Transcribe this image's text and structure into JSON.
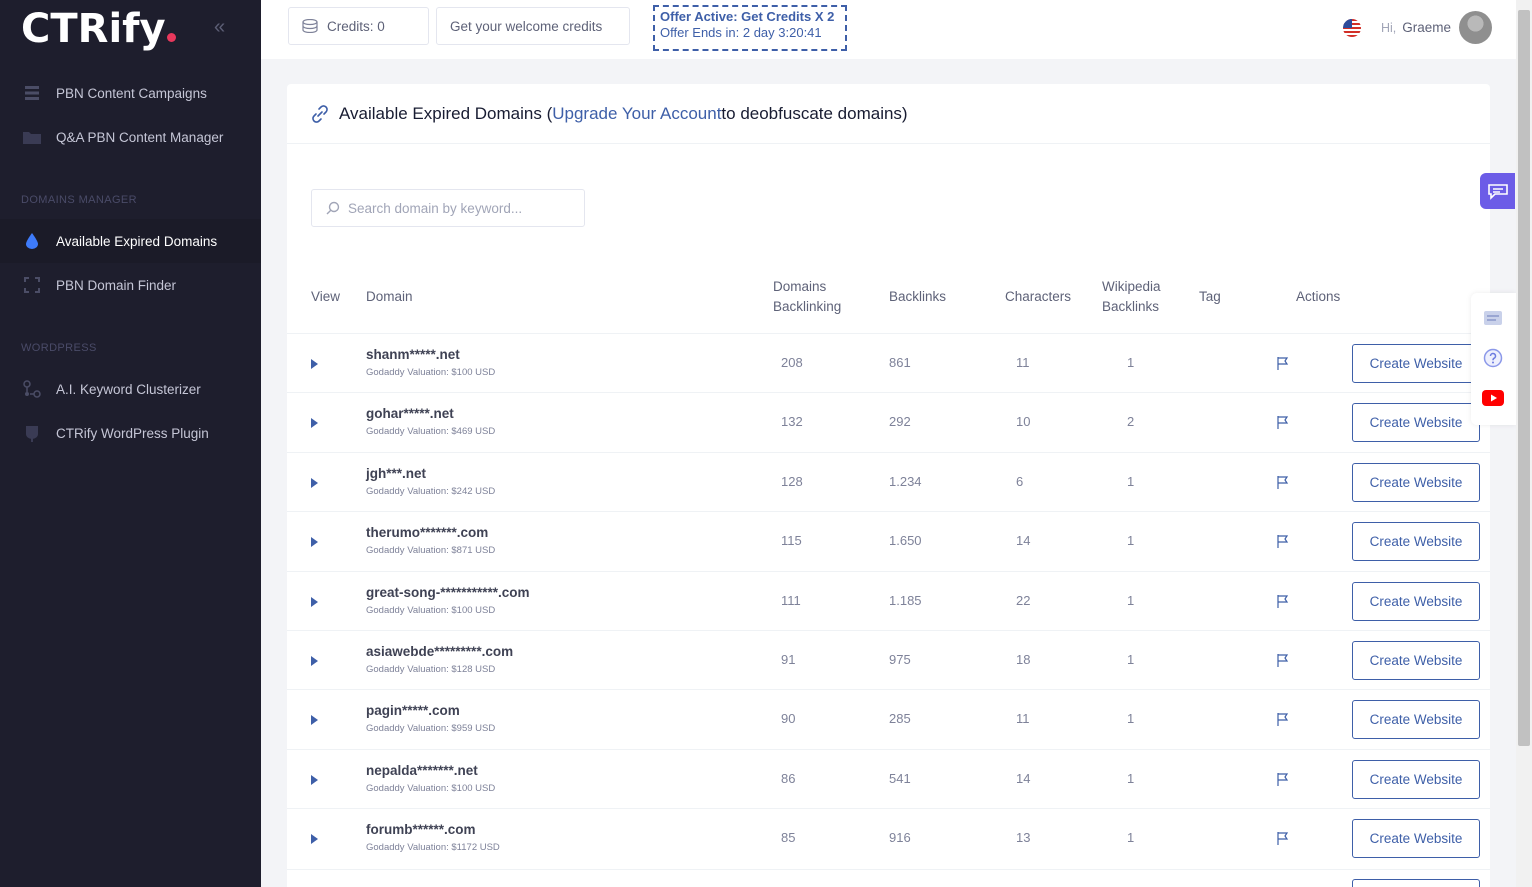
{
  "app": {
    "logo": "CTRify"
  },
  "sidebar": {
    "items": [
      {
        "label": "PBN Content Campaigns",
        "icon": "list-icon"
      },
      {
        "label": "Q&A PBN Content Manager",
        "icon": "folder-icon"
      },
      {
        "label": "Available Expired Domains",
        "icon": "droplet-icon",
        "active": true
      },
      {
        "label": "PBN Domain Finder",
        "icon": "expand-icon"
      },
      {
        "label": "A.I. Keyword Clusterizer",
        "icon": "cluster-icon"
      },
      {
        "label": "CTRify WordPress Plugin",
        "icon": "plugin-icon"
      }
    ],
    "sections": {
      "domains": "DOMAINS MANAGER",
      "wordpress": "WORDPRESS"
    }
  },
  "header": {
    "credits": "Credits: 0",
    "welcome": "Get your welcome credits",
    "offer_line1": "Offer Active: Get Credits X 2",
    "offer_line2": "Offer Ends in: 2 day 3:20:41",
    "greeting": "Hi,",
    "username": "Graeme"
  },
  "card": {
    "title_prefix": "Available Expired Domains (",
    "title_link": "Upgrade Your Account",
    "title_suffix": " to deobfuscate domains)",
    "search_placeholder": "Search domain by keyword..."
  },
  "table": {
    "headers": {
      "view": "View",
      "domain": "Domain",
      "domains_backlinking_1": "Domains",
      "domains_backlinking_2": "Backlinking",
      "backlinks": "Backlinks",
      "characters": "Characters",
      "wikipedia_1": "Wikipedia",
      "wikipedia_2": "Backlinks",
      "tag": "Tag",
      "actions": "Actions"
    },
    "action_label": "Create Website",
    "rows": [
      {
        "domain": "shanm*****.net",
        "valuation": "Godaddy Valuation: $100 USD",
        "domains_backlinking": "208",
        "backlinks": "861",
        "characters": "11",
        "wikipedia": "1"
      },
      {
        "domain": "gohar*****.net",
        "valuation": "Godaddy Valuation: $469 USD",
        "domains_backlinking": "132",
        "backlinks": "292",
        "characters": "10",
        "wikipedia": "2"
      },
      {
        "domain": "jgh***.net",
        "valuation": "Godaddy Valuation: $242 USD",
        "domains_backlinking": "128",
        "backlinks": "1.234",
        "characters": "6",
        "wikipedia": "1"
      },
      {
        "domain": "therumo*******.com",
        "valuation": "Godaddy Valuation: $871 USD",
        "domains_backlinking": "115",
        "backlinks": "1.650",
        "characters": "14",
        "wikipedia": "1"
      },
      {
        "domain": "great-song-***********.com",
        "valuation": "Godaddy Valuation: $100 USD",
        "domains_backlinking": "111",
        "backlinks": "1.185",
        "characters": "22",
        "wikipedia": "1"
      },
      {
        "domain": "asiawebde*********.com",
        "valuation": "Godaddy Valuation: $128 USD",
        "domains_backlinking": "91",
        "backlinks": "975",
        "characters": "18",
        "wikipedia": "1"
      },
      {
        "domain": "pagin*****.com",
        "valuation": "Godaddy Valuation: $959 USD",
        "domains_backlinking": "90",
        "backlinks": "285",
        "characters": "11",
        "wikipedia": "1"
      },
      {
        "domain": "nepalda*******.net",
        "valuation": "Godaddy Valuation: $100 USD",
        "domains_backlinking": "86",
        "backlinks": "541",
        "characters": "14",
        "wikipedia": "1"
      },
      {
        "domain": "forumb******.com",
        "valuation": "Godaddy Valuation: $1172 USD",
        "domains_backlinking": "85",
        "backlinks": "916",
        "characters": "13",
        "wikipedia": "1"
      }
    ]
  },
  "colors": {
    "sidebar": "#1e1e2d",
    "accent": "#3e5fa8",
    "logo_dot": "#e8385c",
    "chat": "#6c5ce7"
  }
}
